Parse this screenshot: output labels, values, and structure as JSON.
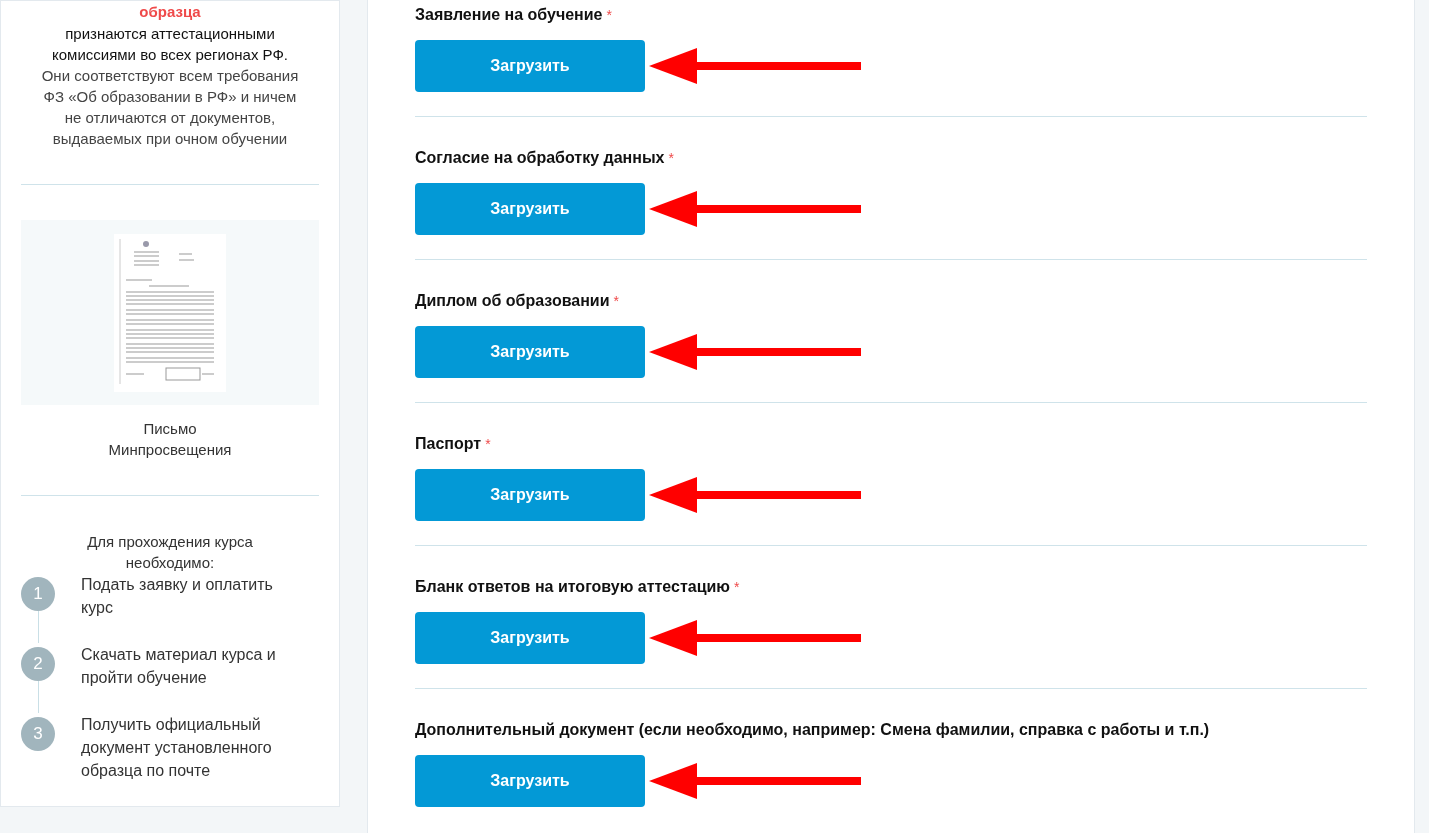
{
  "sidebar": {
    "highlight": "образца",
    "intro_bold": "признаются аттестационными комиссиями во всех регионах РФ.",
    "intro": "Они соответствуют всем требования ФЗ «Об образовании в РФ» и ничем не отличаются от документов, выдаваемых при очном обучении",
    "document_caption": "Письмо Минпросвещения",
    "steps_title": "Для прохождения курса необходимо:",
    "steps": [
      {
        "number": "1",
        "text": "Подать заявку и оплатить курс"
      },
      {
        "number": "2",
        "text": "Скачать материал курса и пройти обучение"
      },
      {
        "number": "3",
        "text": "Получить официальный документ установленного образца по почте"
      }
    ]
  },
  "uploads": [
    {
      "label": "Заявление на обучение",
      "required_mark": "*",
      "button": "Загрузить"
    },
    {
      "label": "Согласие на обработку данных",
      "required_mark": "*",
      "button": "Загрузить"
    },
    {
      "label": "Диплом об образовании",
      "required_mark": "*",
      "button": "Загрузить"
    },
    {
      "label": "Паспорт",
      "required_mark": "*",
      "button": "Загрузить"
    },
    {
      "label": "Бланк ответов на итоговую аттестацию",
      "required_mark": "*",
      "button": "Загрузить"
    },
    {
      "label": "Дополнительный документ (если необходимо, например: Смена фамилии, справка с работы и т.п.)",
      "button": "Загрузить"
    }
  ]
}
